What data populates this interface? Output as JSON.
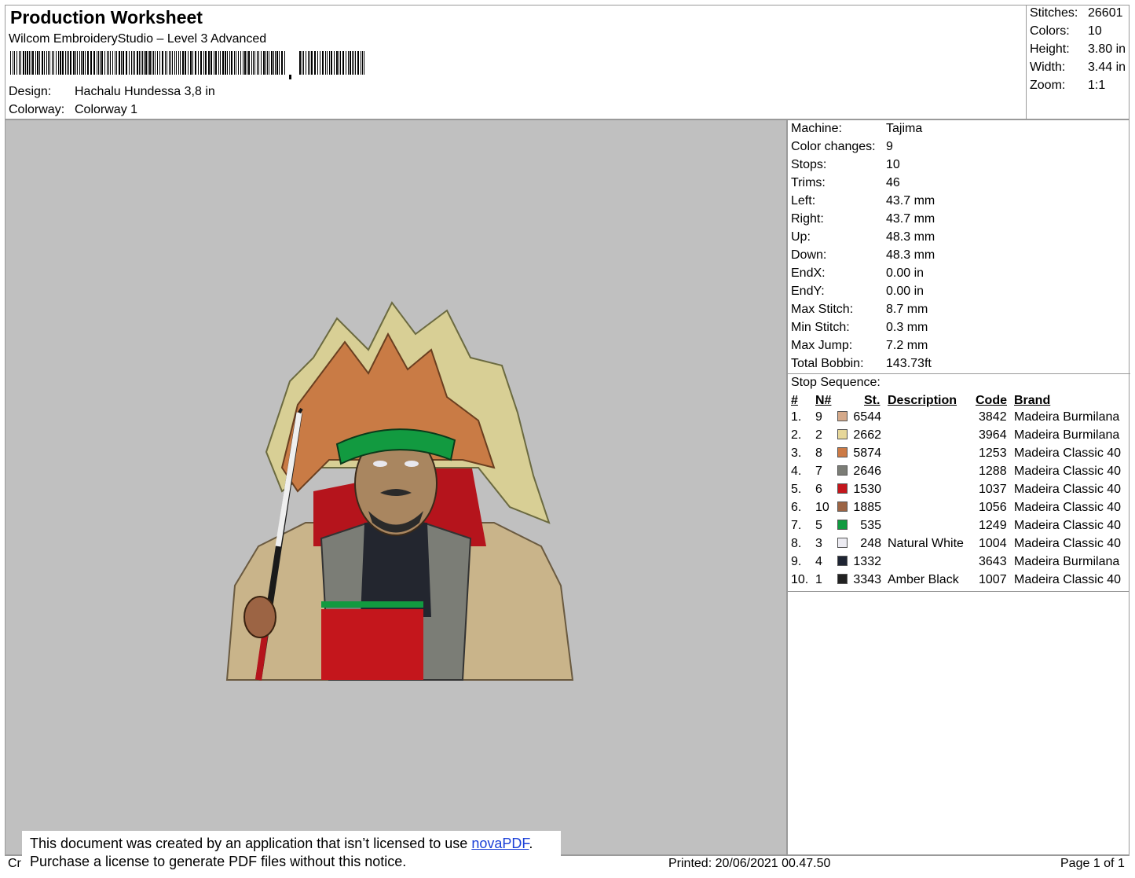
{
  "header": {
    "title": "Production Worksheet",
    "subtitle": "Wilcom EmbroideryStudio – Level 3 Advanced",
    "design_label": "Design:",
    "design_value": "Hachalu Hundessa 3,8 in",
    "colorway_label": "Colorway:",
    "colorway_value": "Colorway 1"
  },
  "stats": [
    {
      "label": "Stitches:",
      "value": "26601"
    },
    {
      "label": "Colors:",
      "value": "10"
    },
    {
      "label": "Height:",
      "value": "3.80 in"
    },
    {
      "label": "Width:",
      "value": "3.44 in"
    },
    {
      "label": "Zoom:",
      "value": "1:1"
    }
  ],
  "info": [
    {
      "label": "Machine:",
      "value": "Tajima"
    },
    {
      "label": "Color changes:",
      "value": "9"
    },
    {
      "label": "Stops:",
      "value": "10"
    },
    {
      "label": "Trims:",
      "value": "46"
    },
    {
      "label": "Left:",
      "value": "43.7 mm"
    },
    {
      "label": "Right:",
      "value": "43.7 mm"
    },
    {
      "label": "Up:",
      "value": "48.3 mm"
    },
    {
      "label": "Down:",
      "value": "48.3 mm"
    },
    {
      "label": "EndX:",
      "value": "0.00 in"
    },
    {
      "label": "EndY:",
      "value": "0.00 in"
    },
    {
      "label": "Max Stitch:",
      "value": "8.7 mm"
    },
    {
      "label": "Min Stitch:",
      "value": "0.3 mm"
    },
    {
      "label": "Max Jump:",
      "value": "7.2 mm"
    },
    {
      "label": "Total Bobbin:",
      "value": "143.73ft"
    }
  ],
  "stop_sequence": {
    "label": "Stop Sequence:",
    "headers": {
      "num": "#",
      "n": "N#",
      "st": "St.",
      "description": "Description",
      "code": "Code",
      "brand": "Brand"
    },
    "rows": [
      {
        "num": "1.",
        "n": "9",
        "color": "#d4a98a",
        "st": "6544",
        "description": "",
        "code": "3842",
        "brand": "Madeira Burmilana"
      },
      {
        "num": "2.",
        "n": "2",
        "color": "#e6d79a",
        "st": "2662",
        "description": "",
        "code": "3964",
        "brand": "Madeira Burmilana"
      },
      {
        "num": "3.",
        "n": "8",
        "color": "#cc7a45",
        "st": "5874",
        "description": "",
        "code": "1253",
        "brand": "Madeira Classic 40"
      },
      {
        "num": "4.",
        "n": "7",
        "color": "#7b7d76",
        "st": "2646",
        "description": "",
        "code": "1288",
        "brand": "Madeira Classic 40"
      },
      {
        "num": "5.",
        "n": "6",
        "color": "#c4161c",
        "st": "1530",
        "description": "",
        "code": "1037",
        "brand": "Madeira Classic 40"
      },
      {
        "num": "6.",
        "n": "10",
        "color": "#9c6444",
        "st": "1885",
        "description": "",
        "code": "1056",
        "brand": "Madeira Classic 40"
      },
      {
        "num": "7.",
        "n": "5",
        "color": "#129a40",
        "st": "535",
        "description": "",
        "code": "1249",
        "brand": "Madeira Classic 40"
      },
      {
        "num": "8.",
        "n": "3",
        "color": "#ecebf2",
        "st": "248",
        "description": "Natural White",
        "code": "1004",
        "brand": "Madeira Classic 40"
      },
      {
        "num": "9.",
        "n": "4",
        "color": "#1f2533",
        "st": "1332",
        "description": "",
        "code": "3643",
        "brand": "Madeira Burmilana"
      },
      {
        "num": "10.",
        "n": "1",
        "color": "#222222",
        "st": "3343",
        "description": "Amber Black",
        "code": "1007",
        "brand": "Madeira Classic 40"
      }
    ]
  },
  "notice": {
    "line1_pre": "This document was created by an application that isn’t licensed to use ",
    "link": "novaPDF",
    "line1_post": ".",
    "line2": "Purchase a license to generate PDF files without this notice."
  },
  "footer": {
    "left_fragment": "Cr",
    "printed": "Printed: 20/06/2021 00.47.50",
    "page": "Page 1 of 1"
  }
}
